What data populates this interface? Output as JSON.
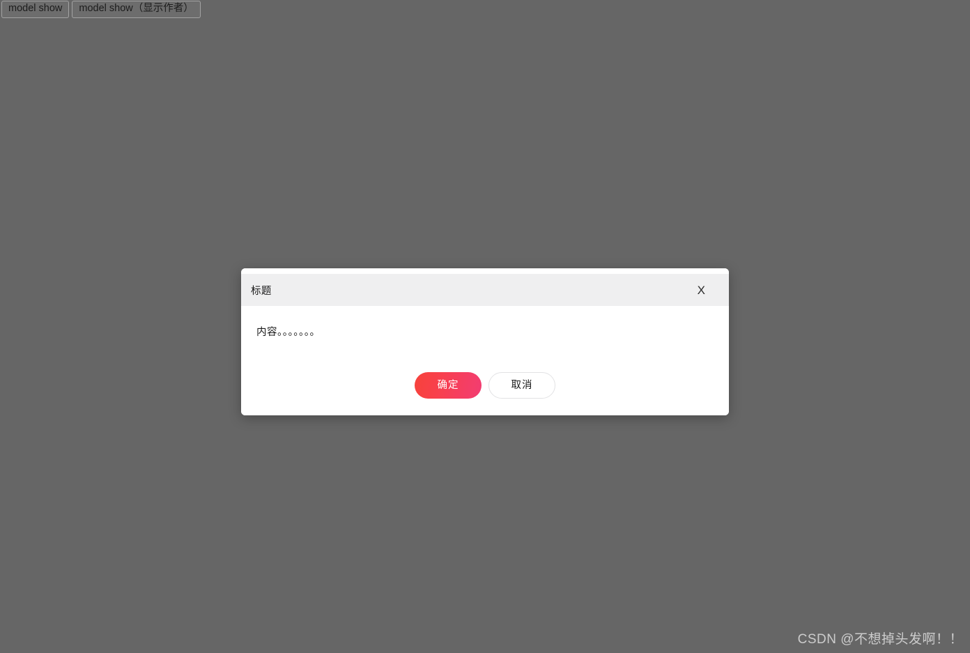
{
  "page": {
    "background_color": "#666666"
  },
  "toolbar": {
    "buttons": [
      {
        "label": "model show"
      },
      {
        "label": "model show（显示作者）"
      }
    ]
  },
  "dialog": {
    "title": "标题",
    "close_label": "X",
    "content": "内容。。。。。。。",
    "buttons": {
      "confirm_label": "确定",
      "cancel_label": "取消"
    },
    "colors": {
      "header_background": "#efeff0",
      "body_background": "#ffffff",
      "confirm_gradient_start": "#f7423b",
      "confirm_gradient_end": "#f23d72",
      "cancel_border": "#e2e2e4"
    }
  },
  "watermark": {
    "text": "CSDN @不想掉头发啊！！"
  }
}
